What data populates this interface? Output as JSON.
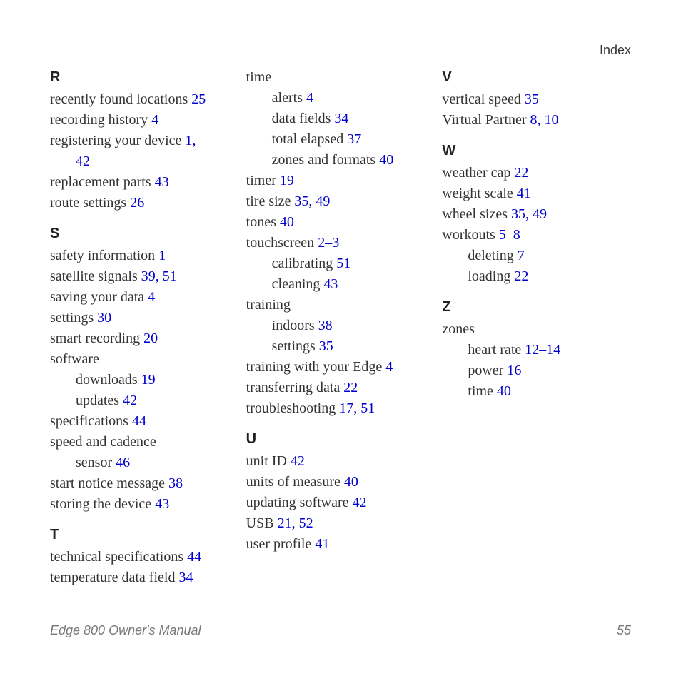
{
  "header": {
    "title": "Index"
  },
  "footer": {
    "manual": "Edge 800 Owner's Manual",
    "page": "55"
  },
  "columns": [
    {
      "groups": [
        {
          "letter": "R",
          "entries": [
            {
              "label": "recently found locations",
              "pages": "25"
            },
            {
              "label": "recording history",
              "pages": "4"
            },
            {
              "label": "registering your device",
              "pages": "1, 42",
              "wrapPages": true
            },
            {
              "label": "replacement parts",
              "pages": "43"
            },
            {
              "label": "route settings",
              "pages": "26"
            }
          ]
        },
        {
          "letter": "S",
          "entries": [
            {
              "label": "safety information",
              "pages": "1"
            },
            {
              "label": "satellite signals",
              "pages": "39, 51"
            },
            {
              "label": "saving your data",
              "pages": "4"
            },
            {
              "label": "settings",
              "pages": "30"
            },
            {
              "label": "smart recording",
              "pages": "20"
            },
            {
              "label": "software",
              "pages": ""
            },
            {
              "label": "downloads",
              "pages": "19",
              "sub": true
            },
            {
              "label": "updates",
              "pages": "42",
              "sub": true
            },
            {
              "label": "specifications",
              "pages": "44"
            },
            {
              "label": "speed and cadence sensor",
              "pages": "46",
              "wrapLabel": true
            },
            {
              "label": "start notice message",
              "pages": "38"
            },
            {
              "label": "storing the device",
              "pages": "43"
            }
          ]
        },
        {
          "letter": "T",
          "entries": [
            {
              "label": "technical specifications",
              "pages": "44"
            },
            {
              "label": "temperature data field",
              "pages": "34"
            }
          ]
        }
      ]
    },
    {
      "groups": [
        {
          "letter": "",
          "entries": [
            {
              "label": "time",
              "pages": ""
            },
            {
              "label": "alerts",
              "pages": "4",
              "sub": true
            },
            {
              "label": "data fields",
              "pages": "34",
              "sub": true
            },
            {
              "label": "total elapsed",
              "pages": "37",
              "sub": true
            },
            {
              "label": "zones and formats",
              "pages": "40",
              "sub": true
            },
            {
              "label": "timer",
              "pages": "19"
            },
            {
              "label": "tire size",
              "pages": "35, 49"
            },
            {
              "label": "tones",
              "pages": "40"
            },
            {
              "label": "touchscreen",
              "pages": "2–3"
            },
            {
              "label": "calibrating",
              "pages": "51",
              "sub": true
            },
            {
              "label": "cleaning",
              "pages": "43",
              "sub": true
            },
            {
              "label": "training",
              "pages": ""
            },
            {
              "label": "indoors",
              "pages": "38",
              "sub": true
            },
            {
              "label": "settings",
              "pages": "35",
              "sub": true
            },
            {
              "label": "training with your Edge",
              "pages": "4"
            },
            {
              "label": "transferring data",
              "pages": "22"
            },
            {
              "label": "troubleshooting",
              "pages": "17, 51"
            }
          ]
        },
        {
          "letter": "U",
          "entries": [
            {
              "label": "unit ID",
              "pages": "42"
            },
            {
              "label": "units of measure",
              "pages": "40"
            },
            {
              "label": "updating software",
              "pages": "42"
            },
            {
              "label": "USB",
              "pages": "21, 52"
            },
            {
              "label": "user profile",
              "pages": "41"
            }
          ]
        }
      ]
    },
    {
      "groups": [
        {
          "letter": "V",
          "entries": [
            {
              "label": "vertical speed",
              "pages": "35"
            },
            {
              "label": "Virtual Partner",
              "pages": "8, 10"
            }
          ]
        },
        {
          "letter": "W",
          "entries": [
            {
              "label": "weather cap",
              "pages": "22"
            },
            {
              "label": "weight scale",
              "pages": "41"
            },
            {
              "label": "wheel sizes",
              "pages": "35, 49"
            },
            {
              "label": "workouts",
              "pages": "5–8"
            },
            {
              "label": "deleting",
              "pages": "7",
              "sub": true
            },
            {
              "label": "loading",
              "pages": "22",
              "sub": true
            }
          ]
        },
        {
          "letter": "Z",
          "entries": [
            {
              "label": "zones",
              "pages": ""
            },
            {
              "label": "heart rate",
              "pages": "12–14",
              "sub": true
            },
            {
              "label": "power",
              "pages": "16",
              "sub": true
            },
            {
              "label": "time",
              "pages": "40",
              "sub": true
            }
          ]
        }
      ]
    }
  ]
}
